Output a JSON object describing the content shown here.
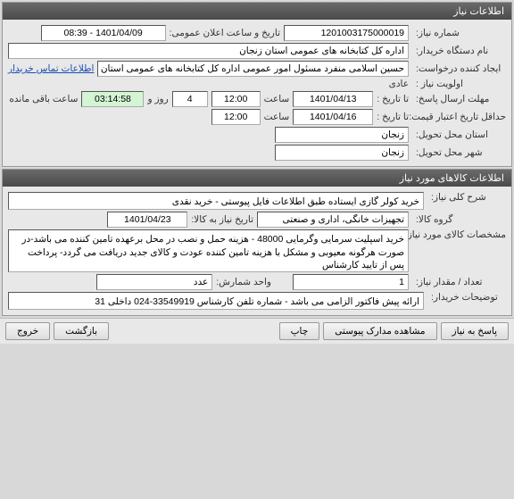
{
  "panel1": {
    "title": "اطلاعات نیاز",
    "need_number_label": "شماره نیاز:",
    "need_number": "1201003175000019",
    "announce_label": "تاریخ و ساعت اعلان عمومی:",
    "announce_datetime": "1401/04/09 - 08:39",
    "buyer_org_label": "نام دستگاه خریدار:",
    "buyer_org": "اداره کل کتابخانه های عمومی استان زنجان",
    "requester_label": "ایجاد کننده درخواست:",
    "requester": "حسین اسلامی منفرد مسئول امور عمومی اداره کل کتابخانه های عمومی استان",
    "buyer_contact_link": "اطلاعات تماس خریدار",
    "priority_label": "اولویت نیاز :",
    "priority": "عادی",
    "deadline_reply_label": "مهلت ارسال پاسخ:",
    "to_date_label": "تا تاریخ :",
    "deadline_date": "1401/04/13",
    "hour_label": "ساعت",
    "deadline_time": "12:00",
    "days_field": "4",
    "days_and_label": "روز و",
    "countdown": "03:14:58",
    "remaining_label": "ساعت باقی مانده",
    "min_credit_label": "حداقل تاریخ اعتبار قیمت:",
    "credit_date": "1401/04/16",
    "credit_time": "12:00",
    "delivery_province_label": "استان محل تحویل:",
    "delivery_province": "زنجان",
    "delivery_city_label": "شهر محل تحویل:",
    "delivery_city": "زنجان"
  },
  "panel2": {
    "title": "اطلاعات کالاهای مورد نیاز",
    "general_desc_label": "شرح کلی نیاز:",
    "general_desc": "خرید کولر گازی ایستاده طبق اطلاعات فایل پیوستی - خرید نقدی",
    "group_label": "گروه کالا:",
    "group": "تجهیزات خانگی، اداری و صنعتی",
    "need_by_label": "تاریخ نیاز به کالا:",
    "need_by_date": "1401/04/23",
    "spec_label": "مشخصات کالای مورد نیاز:",
    "spec": "خرید اسپلیت سرمایی وگرمایی 48000 - هزینه حمل و نصب در محل برعهده تامین کننده می باشد-در صورت هرگونه معیوبی و مشکل با هزینه تامین کننده عودت و کالای جدید دریافت می گردد- پرداخت پس از تایید کارشناس",
    "qty_label": "تعداد / مقدار نیاز:",
    "qty": "1",
    "unit_label": "واحد شمارش:",
    "unit": "عدد",
    "buyer_note_label": "توضیحات خریدار:",
    "buyer_note": "ارائه پیش فاکتور الزامی می باشد - شماره تلفن کارشناس 33549919-024 داخلی 31"
  },
  "buttons": {
    "reply": "پاسخ به نیاز",
    "attachments": "مشاهده مدارک پیوستی",
    "print": "چاپ",
    "back": "بازگشت",
    "exit": "خروج"
  }
}
